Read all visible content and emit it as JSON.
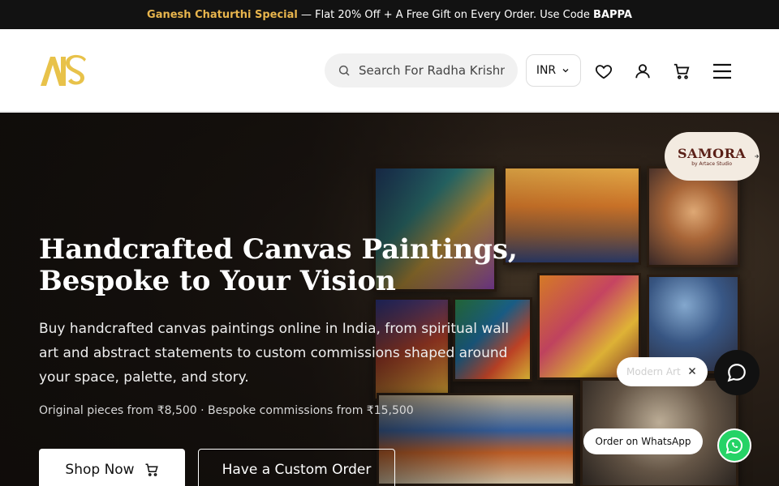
{
  "announcement": {
    "highlight": "Ganesh Chaturthi Special",
    "text": " — Flat 20% Off + A Free Gift on Every Order. Use Code ",
    "code": "BAPPA"
  },
  "header": {
    "logo_icon": "artace-logo",
    "search": {
      "placeholder": "Search For Radha Krishna",
      "icon": "search-icon"
    },
    "currency": {
      "selected": "INR",
      "icon": "chevron-down-icon"
    },
    "icons": [
      "heart-icon",
      "user-icon",
      "cart-icon",
      "menu-icon"
    ]
  },
  "hero": {
    "title_line1": "Handcrafted Canvas Paintings,",
    "title_line2": "Bespoke to Your Vision",
    "description": "Buy handcrafted canvas paintings online in India, from spiritual wall art and abstract statements to custom commissions shaped around your space, palette, and story.",
    "price_note": "Original pieces from ₹8,500 · Bespoke commissions from ₹15,500",
    "shop_label": "Shop Now",
    "custom_label": "Have a Custom Order"
  },
  "samora": {
    "name": "SAMORA",
    "sub": "by Artace Studio"
  },
  "floating": {
    "tag_label": "Modern Art",
    "whatsapp_label": "Order on WhatsApp"
  },
  "colors": {
    "accent": "#e8b54d",
    "whatsapp": "#25d366",
    "dark": "#121212"
  }
}
